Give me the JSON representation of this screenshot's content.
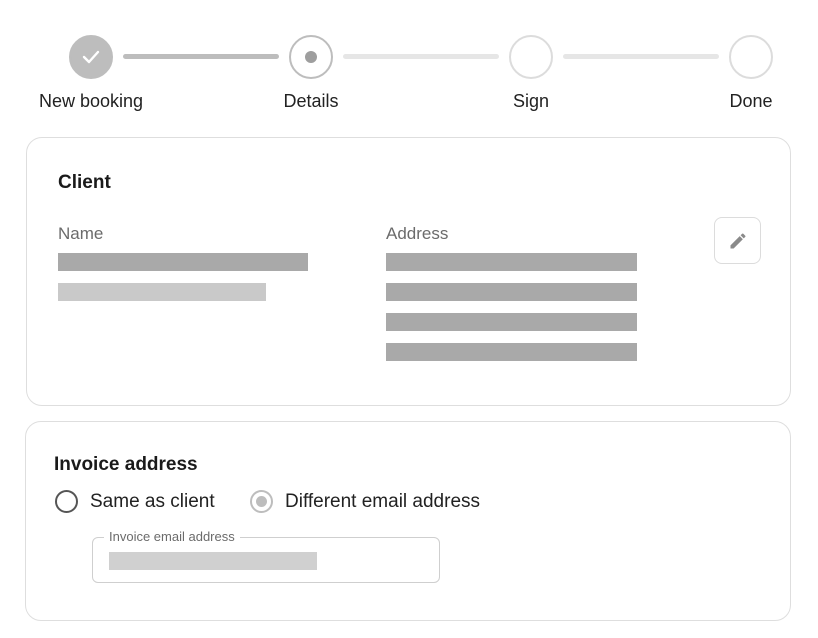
{
  "stepper": {
    "steps": [
      {
        "label": "New booking",
        "state": "completed",
        "icon": "check-icon"
      },
      {
        "label": "Details",
        "state": "active",
        "icon": "dot-icon"
      },
      {
        "label": "Sign",
        "state": "pending"
      },
      {
        "label": "Done",
        "state": "pending"
      }
    ]
  },
  "client": {
    "title": "Client",
    "name_label": "Name",
    "address_label": "Address",
    "edit_icon": "pencil-icon"
  },
  "invoice": {
    "title": "Invoice address",
    "options": [
      {
        "label": "Same as client",
        "checked": false
      },
      {
        "label": "Different email address",
        "checked": true
      }
    ],
    "email_field": {
      "label": "Invoice email address"
    }
  },
  "colors": {
    "completed": "#bdbdbd",
    "inactive": "#e6e6e6",
    "placeholder_dark": "#a9a9a9",
    "placeholder_light": "#c9c9c9"
  }
}
